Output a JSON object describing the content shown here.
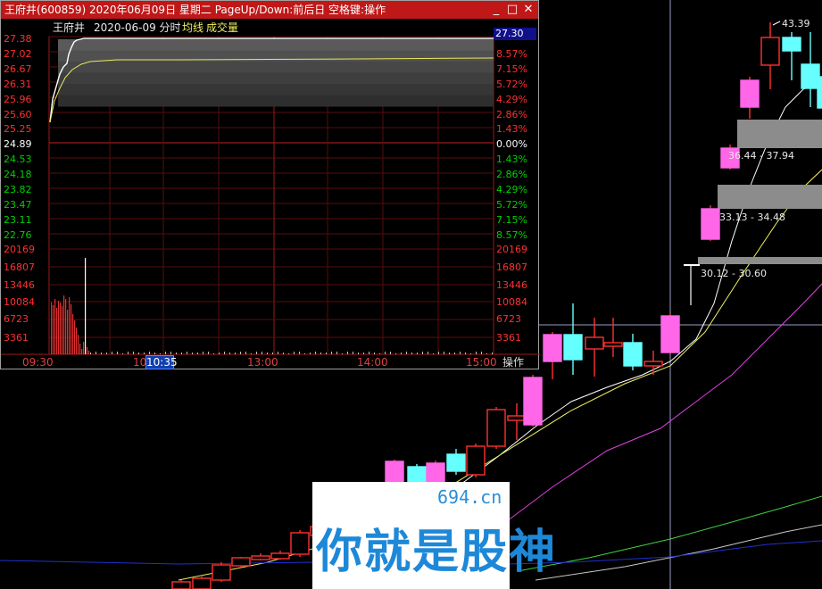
{
  "window": {
    "title": "王府井(600859)  2020年06月09日  星期二  PageUp/Down:前后日  空格键:操作",
    "minimize_glyph": "_",
    "restore_glyph": "□",
    "close_glyph": "✕"
  },
  "header": {
    "stock_name": "王府井",
    "date_mode": "2020-06-09 分时",
    "avg_line_label": "均线",
    "volume_label": "成交量"
  },
  "price_axis": {
    "labels": [
      "27.38",
      "27.02",
      "26.67",
      "26.31",
      "25.96",
      "25.60",
      "25.25",
      "24.89",
      "24.53",
      "24.18",
      "23.82",
      "23.47",
      "23.11",
      "22.76"
    ],
    "pct_labels": [
      "",
      "8.57%",
      "7.15%",
      "5.72%",
      "4.29%",
      "2.86%",
      "1.43%",
      "0.00%",
      "1.43%",
      "2.86%",
      "4.29%",
      "5.72%",
      "7.15%",
      "8.57%"
    ],
    "current_price": "27.30"
  },
  "volume_axis": {
    "left_labels": [
      "20169",
      "16807",
      "13446",
      "10084",
      "6723",
      "3361"
    ],
    "right_labels": [
      "20169",
      "16807",
      "13446",
      "10084",
      "6723",
      "3361"
    ]
  },
  "time_axis": {
    "ticks": [
      "09:30",
      "10:",
      "13:00",
      "14:00",
      "15:00"
    ],
    "cursor_time": "10:35",
    "ops_label": "操作"
  },
  "colors": {
    "up": "#ff3030",
    "down": "#00c000",
    "neutral": "#ffffff",
    "avg_line": "#e8e860",
    "title_bar": "#c01818",
    "up_candle_fill": "#ff66e8",
    "down_candle_fill": "#66ffff"
  },
  "kline": {
    "ranges": [
      "36.44 - 37.94",
      "33.13 - 34.48",
      "30.12 - 30.60"
    ],
    "peak_label": "43.39"
  },
  "watermark": {
    "site": "694.cn",
    "slogan": "你就是股神"
  }
}
